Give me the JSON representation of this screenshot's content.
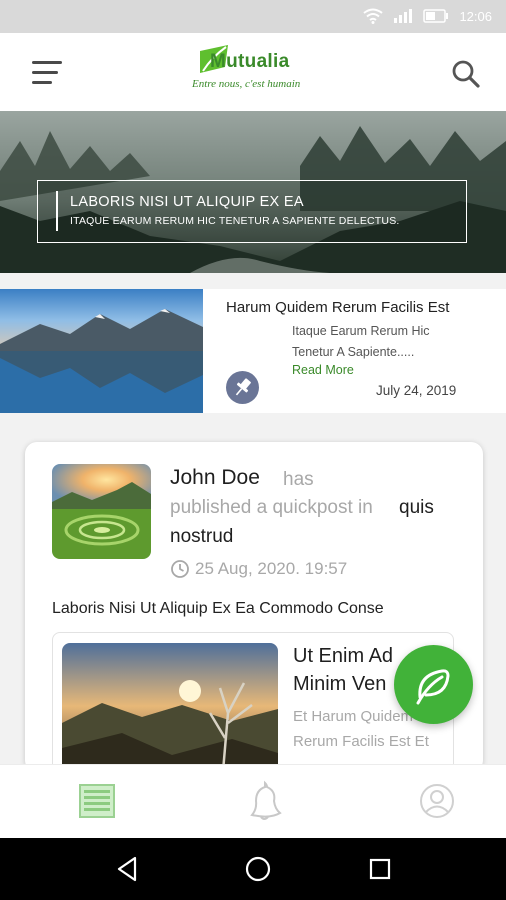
{
  "status_bar": {
    "time": "12:06",
    "icons": [
      "wifi-icon",
      "signal-icon",
      "battery-icon"
    ]
  },
  "header": {
    "logo_word": "Mutualia",
    "logo_tagline": "Entre nous, c'est humain",
    "menu_icon": "hamburger-menu-icon",
    "search_icon": "search-icon"
  },
  "hero": {
    "title": "LABORIS NISI UT ALIQUIP EX EA",
    "subtitle": "ITAQUE EARUM RERUM HIC TENETUR A SAPIENTE DELECTUS."
  },
  "article": {
    "title": "Harum Quidem Rerum Facilis Est",
    "excerpt_line1": "Itaque Earum Rerum Hic",
    "excerpt_line2": "Tenetur A Sapiente.....",
    "read_more": "Read More",
    "date": "July 24, 2019",
    "pin_icon": "pin-icon"
  },
  "feed_post": {
    "author": "John Doe",
    "verb": "has",
    "action": "published a quickpost in",
    "category_line1": "quis",
    "category_line2": "nostrud",
    "timestamp": "25 Aug, 2020. 19:57",
    "text": "Laboris Nisi Ut Aliquip Ex Ea Commodo Conse",
    "embedded": {
      "title_line1": "Ut Enim Ad",
      "title_line2": "Minim Ven",
      "sub_line1": "Et Harum Quidem",
      "sub_line2": "Rerum Facilis Est Et"
    }
  },
  "fab": {
    "icon": "leaf-icon"
  },
  "tab_bar": {
    "tabs": [
      {
        "name": "news",
        "icon": "newspaper-icon",
        "active": true
      },
      {
        "name": "notifications",
        "icon": "bell-icon",
        "active": false
      },
      {
        "name": "profile",
        "icon": "user-icon",
        "active": false
      }
    ]
  },
  "nav_bar": {
    "icons": [
      "back-icon",
      "home-icon",
      "recent-apps-icon"
    ]
  },
  "colors": {
    "brand_green": "#41b239",
    "logo_green": "#3a8a2a",
    "pin_blue": "#6a7596",
    "muted_text": "#a8a8a8"
  }
}
